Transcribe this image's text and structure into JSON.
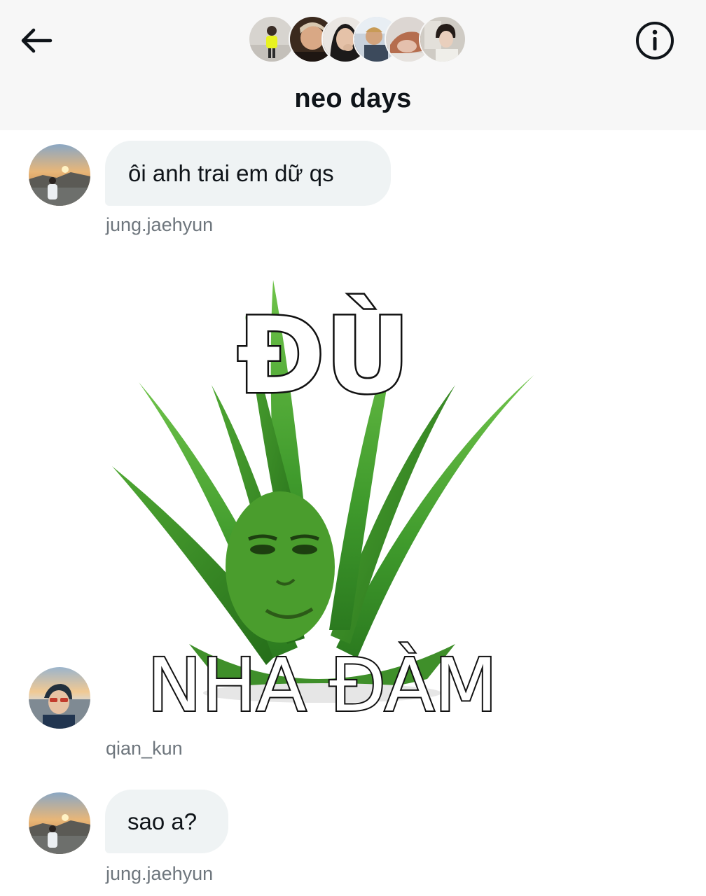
{
  "header": {
    "title": "neo days",
    "back_icon": "arrow-left-icon",
    "info_icon": "info-icon",
    "member_count_shown": 6
  },
  "messages": [
    {
      "type": "text",
      "text": "ôi anh trai em dữ qs",
      "sender": "jung.jaehyun"
    },
    {
      "type": "sticker",
      "sticker_top": "ĐÙ",
      "sticker_bottom": "NHA ĐÀM",
      "sender": "qian_kun"
    },
    {
      "type": "text",
      "text": "sao a?",
      "sender": "jung.jaehyun"
    }
  ],
  "colors": {
    "header_bg": "#f7f7f7",
    "bubble_bg": "#eff3f4",
    "sender_text": "#6e767d",
    "aloe_green": "#3f9a2c"
  }
}
